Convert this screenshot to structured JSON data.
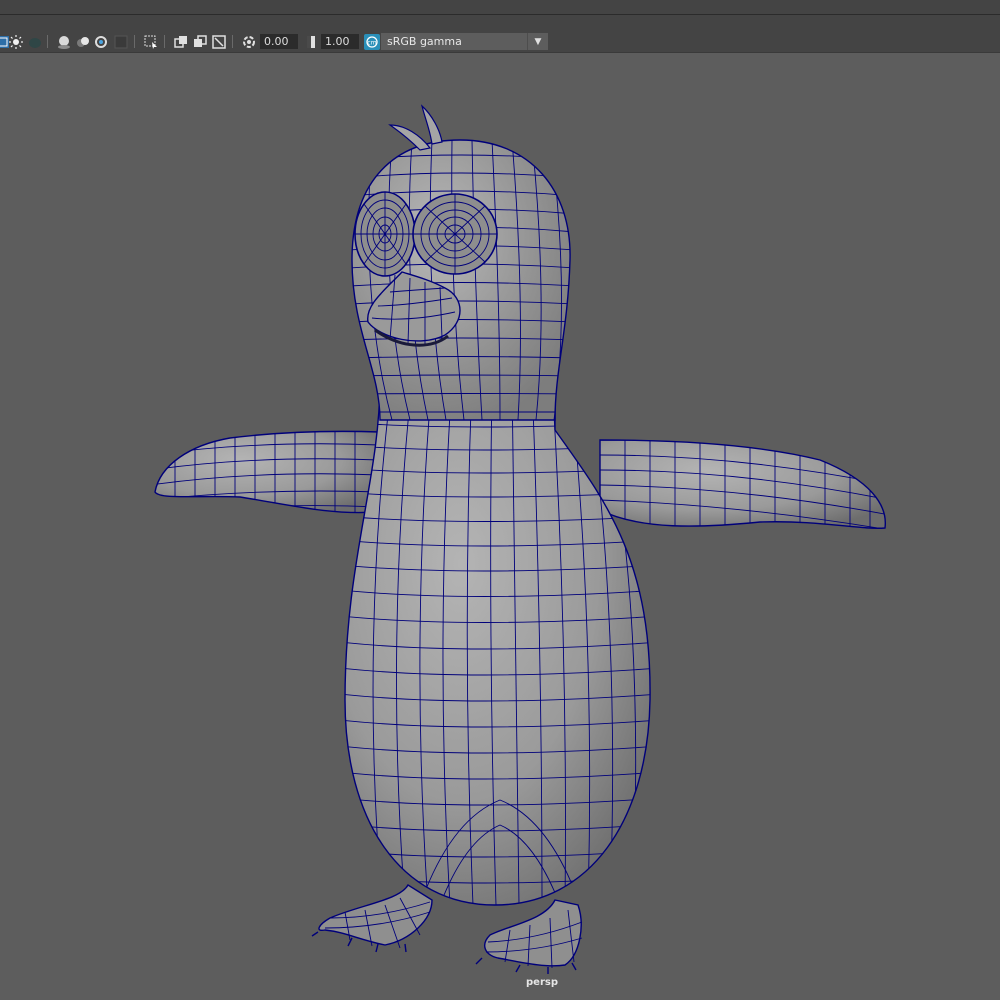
{
  "toolbar": {
    "icons": [
      "wireframe-shaded-icon",
      "lighting-icon",
      "shadows-icon",
      "ambient-occlusion-icon",
      "motion-blur-icon",
      "anti-aliasing-icon",
      "depth-of-field-icon",
      "isolate-select-icon",
      "xray-icon",
      "xray-joints-icon",
      "xray-active-icon",
      "backface-icon",
      "exposure-icon",
      "gamma-icon",
      "color-management-icon"
    ],
    "exposure_value": "0.00",
    "gamma_value": "1.00",
    "color_space": "sRGB gamma"
  },
  "viewport": {
    "camera_label": "persp",
    "background_color": "#5d5d5d",
    "mesh_surface_color": "#9d9d9d",
    "wire_color": "#00007a",
    "toolbar_color": "#444444"
  }
}
